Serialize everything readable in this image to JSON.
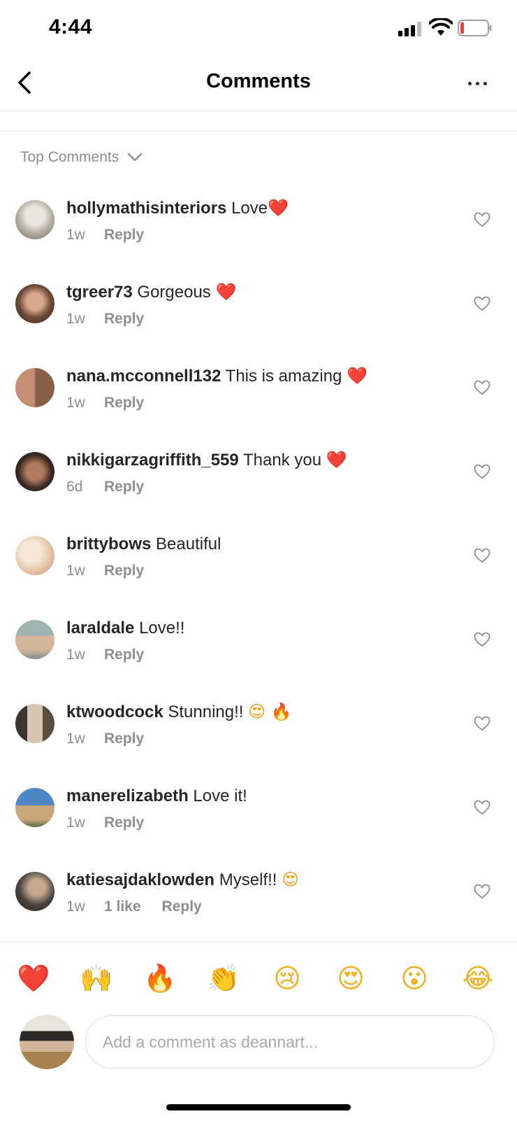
{
  "status_bar": {
    "time": "4:44"
  },
  "header": {
    "title": "Comments"
  },
  "sort": {
    "label": "Top Comments"
  },
  "comments": [
    {
      "username": "hollymathisinteriors",
      "text": "Love",
      "emoji": "❤️",
      "age": "1w",
      "likes": "",
      "reply": "Reply"
    },
    {
      "username": "tgreer73",
      "text": "Gorgeous ",
      "emoji": "❤️",
      "age": "1w",
      "likes": "",
      "reply": "Reply"
    },
    {
      "username": "nana.mcconnell132",
      "text": "This is amazing ",
      "emoji": "❤️",
      "age": "1w",
      "likes": "",
      "reply": "Reply"
    },
    {
      "username": "nikkigarzagriffith_559",
      "text": "Thank you ",
      "emoji": "❤️",
      "age": "6d",
      "likes": "",
      "reply": "Reply"
    },
    {
      "username": "brittybows",
      "text": "Beautiful",
      "emoji": "",
      "age": "1w",
      "likes": "",
      "reply": "Reply"
    },
    {
      "username": "laraldale",
      "text": "Love!!",
      "emoji": "",
      "age": "1w",
      "likes": "",
      "reply": "Reply"
    },
    {
      "username": "ktwoodcock",
      "text": "Stunning!! ",
      "emoji": "😍 🔥",
      "age": "1w",
      "likes": "",
      "reply": "Reply"
    },
    {
      "username": "manerelizabeth",
      "text": "Love it!",
      "emoji": "",
      "age": "1w",
      "likes": "",
      "reply": "Reply"
    },
    {
      "username": "katiesajdaklowden",
      "text": "Myself!! ",
      "emoji": "😍",
      "age": "1w",
      "likes": "1 like",
      "reply": "Reply"
    }
  ],
  "emoji_bar": [
    "❤️",
    "🙌",
    "🔥",
    "👏",
    "😢",
    "😍",
    "😮",
    "😂"
  ],
  "composer": {
    "placeholder": "Add a comment as deannart..."
  },
  "colors": {
    "heart_red": "#ed4956",
    "secondary_text": "#8e8e8e",
    "primary_text": "#262626"
  }
}
